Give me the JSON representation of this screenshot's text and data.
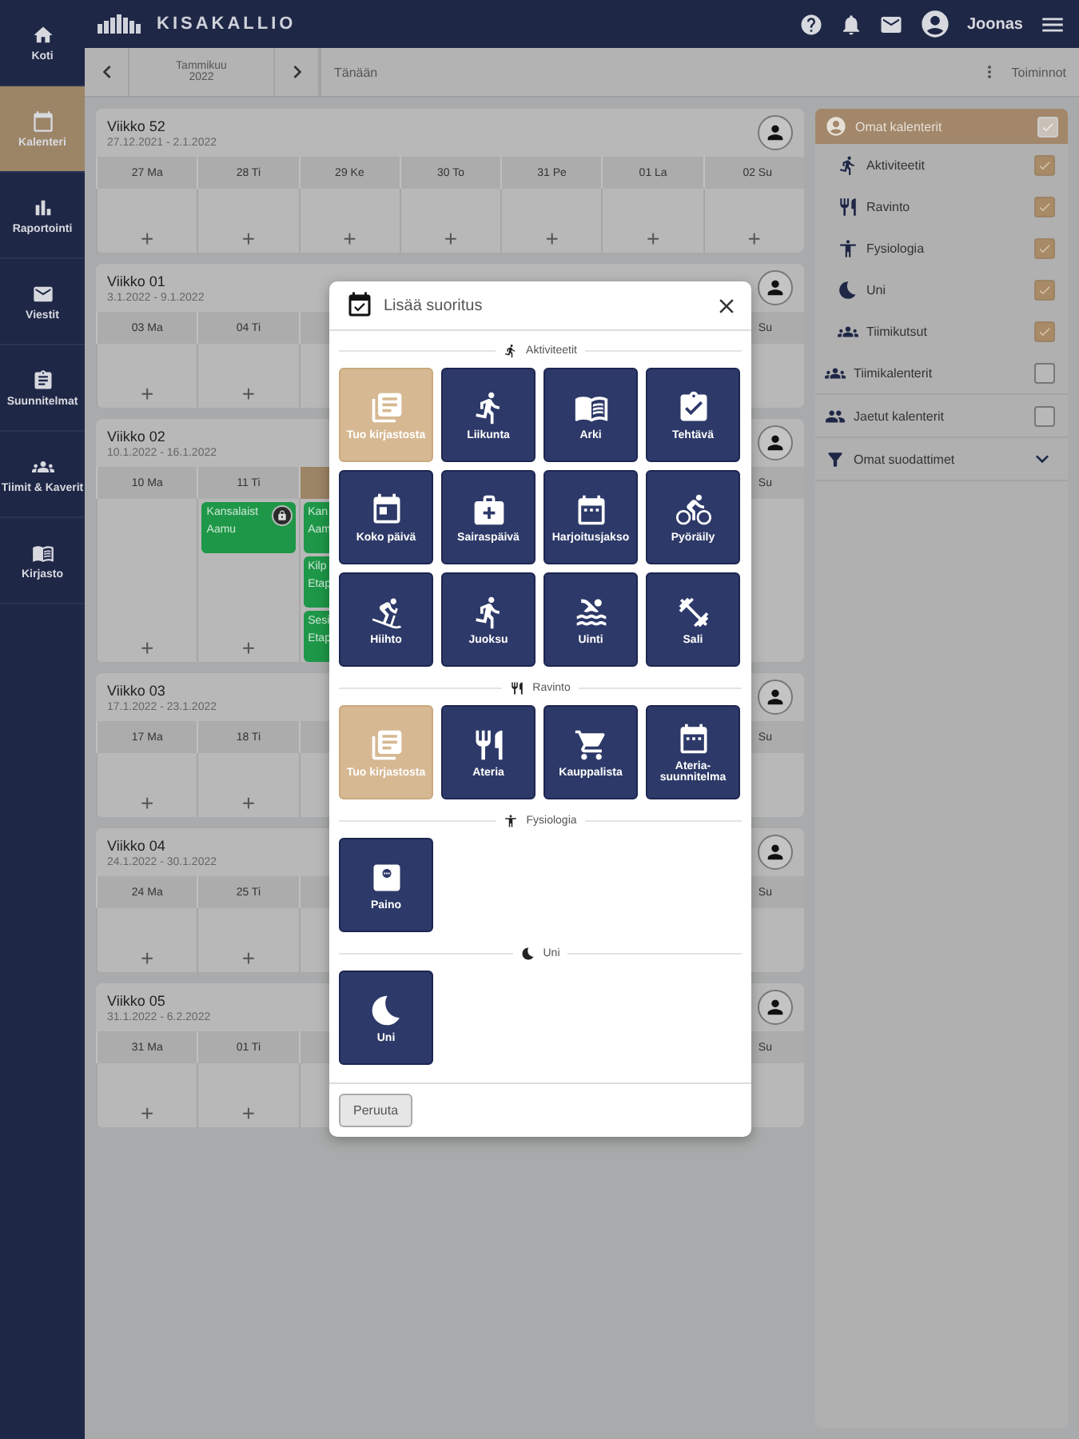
{
  "sidebar": {
    "items": [
      {
        "label": "Koti",
        "selected": false
      },
      {
        "label": "Kalenteri",
        "selected": true
      },
      {
        "label": "Raportointi",
        "selected": false
      },
      {
        "label": "Viestit",
        "selected": false
      },
      {
        "label": "Suunnitelmat",
        "selected": false
      },
      {
        "label": "Tiimit & Kaverit",
        "selected": false
      },
      {
        "label": "Kirjasto",
        "selected": false
      }
    ]
  },
  "header": {
    "logo": "KISAKALLIO",
    "user": "Joonas"
  },
  "toolbar": {
    "month": "Tammikuu",
    "year": "2022",
    "today": "Tänään",
    "actions": "Toiminnot"
  },
  "weeks": [
    {
      "title": "Viikko 52",
      "range": "27.12.2021 - 2.1.2022",
      "days": [
        {
          "label": "27 Ma",
          "add": "+",
          "today": false
        },
        {
          "label": "28 Ti",
          "add": "+",
          "today": false
        },
        {
          "label": "29 Ke",
          "add": "+",
          "today": false
        },
        {
          "label": "30 To",
          "add": "+",
          "today": false
        },
        {
          "label": "31 Pe",
          "add": "+",
          "today": false
        },
        {
          "label": "01 La",
          "add": "+",
          "today": false
        },
        {
          "label": "02 Su",
          "add": "+",
          "today": false
        }
      ]
    },
    {
      "title": "Viikko 01",
      "range": "3.1.2022 - 9.1.2022",
      "days": [
        {
          "label": "03 Ma",
          "add": "+",
          "today": false
        },
        {
          "label": "04 Ti",
          "add": "+",
          "today": false
        }
      ],
      "last_day": {
        "label": "Su",
        "today": false
      }
    },
    {
      "title": "Viikko 02",
      "range": "10.1.2022 - 16.1.2022",
      "days": [
        {
          "label": "10 Ma",
          "add": "+",
          "today": false
        },
        {
          "label": "11 Ti",
          "add": "+",
          "today": false,
          "events": [
            {
              "title": "Kansalaist",
              "time": "Aamu",
              "badge": true
            }
          ]
        },
        {
          "today": true,
          "events": [
            {
              "title": "Kan",
              "time": "Aam"
            },
            {
              "title": "Kilp",
              "time": "Etap"
            },
            {
              "title": "Sesi",
              "time": "Etap"
            }
          ]
        }
      ],
      "last_day": {
        "label": "Su",
        "today": false
      }
    },
    {
      "title": "Viikko 03",
      "range": "17.1.2022 - 23.1.2022",
      "days": [
        {
          "label": "17 Ma",
          "add": "+",
          "today": false
        },
        {
          "label": "18 Ti",
          "add": "+",
          "today": false
        }
      ],
      "last_day": {
        "label": "Su",
        "today": false
      }
    },
    {
      "title": "Viikko 04",
      "range": "24.1.2022 - 30.1.2022",
      "days": [
        {
          "label": "24 Ma",
          "add": "+",
          "today": false
        },
        {
          "label": "25 Ti",
          "add": "+",
          "today": false
        }
      ],
      "last_day": {
        "label": "Su",
        "today": false
      }
    },
    {
      "title": "Viikko 05",
      "range": "31.1.2022 - 6.2.2022",
      "days": [
        {
          "label": "31 Ma",
          "add": "+",
          "today": false
        },
        {
          "label": "01 Ti",
          "add": "+",
          "today": false
        }
      ],
      "last_day": {
        "label": "Su",
        "today": false
      }
    }
  ],
  "filters": {
    "header": {
      "label": "Omat kalenterit",
      "checked": true
    },
    "items": [
      {
        "label": "Aktiviteetit",
        "kind": "sub",
        "checked": true
      },
      {
        "label": "Ravinto",
        "kind": "sub",
        "checked": true
      },
      {
        "label": "Fysiologia",
        "kind": "sub",
        "checked": true
      },
      {
        "label": "Uni",
        "kind": "sub",
        "checked": true
      },
      {
        "label": "Tiimikutsut",
        "kind": "sub",
        "checked": true
      },
      {
        "label": "Tiimikalenterit",
        "kind": "group",
        "checked": false
      },
      {
        "label": "Jaetut kalenterit",
        "kind": "group",
        "checked": false
      },
      {
        "label": "Omat suodattimet",
        "kind": "expander",
        "expanded": false
      }
    ]
  },
  "dialog": {
    "title": "Lisää suoritus",
    "cancel": "Peruuta",
    "sections": [
      {
        "label": "Aktiviteetit",
        "tiles": [
          {
            "label": "Tuo kirjastosta",
            "kind": "import"
          },
          {
            "label": "Liikunta",
            "kind": "entry"
          },
          {
            "label": "Arki",
            "kind": "entry"
          },
          {
            "label": "Tehtävä",
            "kind": "entry"
          },
          {
            "label": "Koko päivä",
            "kind": "entry"
          },
          {
            "label": "Sairaspäivä",
            "kind": "entry"
          },
          {
            "label": "Harjoitusjakso",
            "kind": "entry"
          },
          {
            "label": "Pyöräily",
            "kind": "entry"
          },
          {
            "label": "Hiihto",
            "kind": "entry"
          },
          {
            "label": "Juoksu",
            "kind": "entry"
          },
          {
            "label": "Uinti",
            "kind": "entry"
          },
          {
            "label": "Sali",
            "kind": "entry"
          }
        ]
      },
      {
        "label": "Ravinto",
        "tiles": [
          {
            "label": "Tuo kirjastosta",
            "kind": "import"
          },
          {
            "label": "Ateria",
            "kind": "entry"
          },
          {
            "label": "Kauppalista",
            "kind": "entry"
          },
          {
            "label": "Ateria-suunnitelma",
            "kind": "entry"
          }
        ]
      },
      {
        "label": "Fysiologia",
        "tiles": [
          {
            "label": "Paino",
            "kind": "entry"
          }
        ]
      },
      {
        "label": "Uni",
        "tiles": [
          {
            "label": "Uni",
            "kind": "entry"
          }
        ]
      }
    ]
  }
}
